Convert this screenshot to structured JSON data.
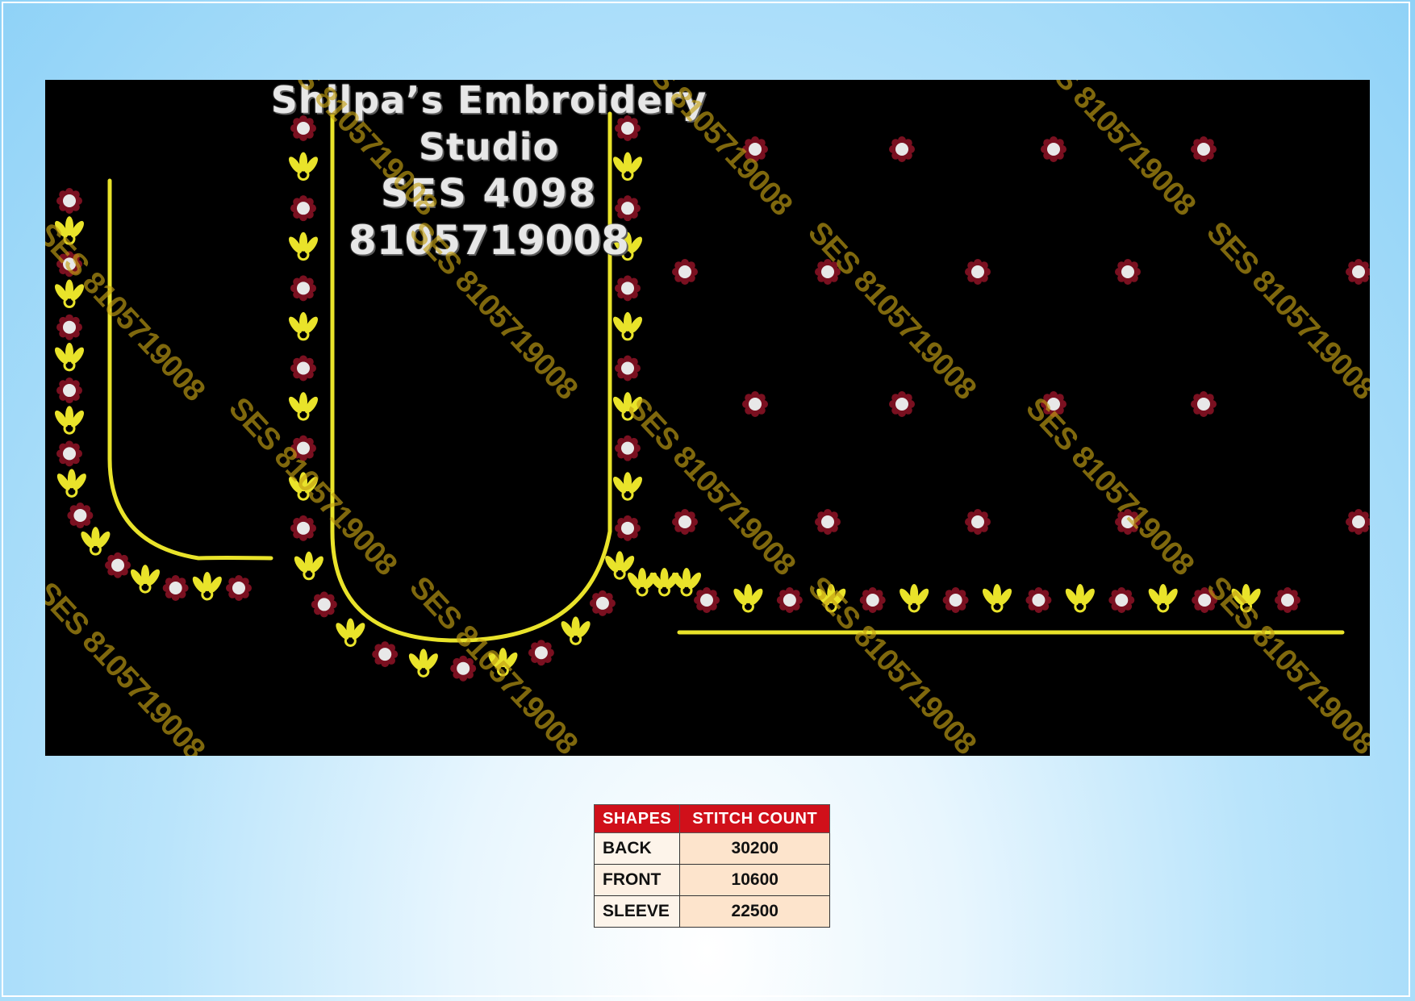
{
  "studio": {
    "name": "Shilpa’s Embroidery Studio",
    "design_code": "SES 4098",
    "phone": "8105719008"
  },
  "watermark_text": "SES 8105719008",
  "colors": {
    "background_panel": "#000000",
    "thread_gold": "#e9e32a",
    "flower_maroon": "#7a1020",
    "pearl": "#e8e8e8",
    "table_header": "#d0101a"
  },
  "stitch_table": {
    "headers": [
      "SHAPES",
      "STITCH COUNT"
    ],
    "rows": [
      {
        "shape": "BACK",
        "count": "30200"
      },
      {
        "shape": "FRONT",
        "count": "10600"
      },
      {
        "shape": "SLEEVE",
        "count": "22500"
      }
    ]
  }
}
